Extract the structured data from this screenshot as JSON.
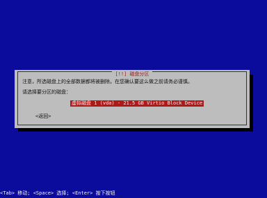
{
  "dialog": {
    "title": "[!!] 磁盘分区",
    "warning_text": "注意，所选磁盘上的全部数据都将被删除。在您确认要这么做之前请务必谨慎。",
    "prompt": "请选择要分区的磁盘：",
    "disk_option": "虚拟磁盘 1 (vda) - 21.5 GB Virtio Block Device",
    "back_button": "<返回>"
  },
  "footer": {
    "hint": "<Tab> 移动; <Space> 选择; <Enter> 按下按钮"
  },
  "colors": {
    "background": "#0b0b9c",
    "dialog": "#bdbdbd",
    "selection": "#b11818",
    "title_text": "#a21717"
  }
}
